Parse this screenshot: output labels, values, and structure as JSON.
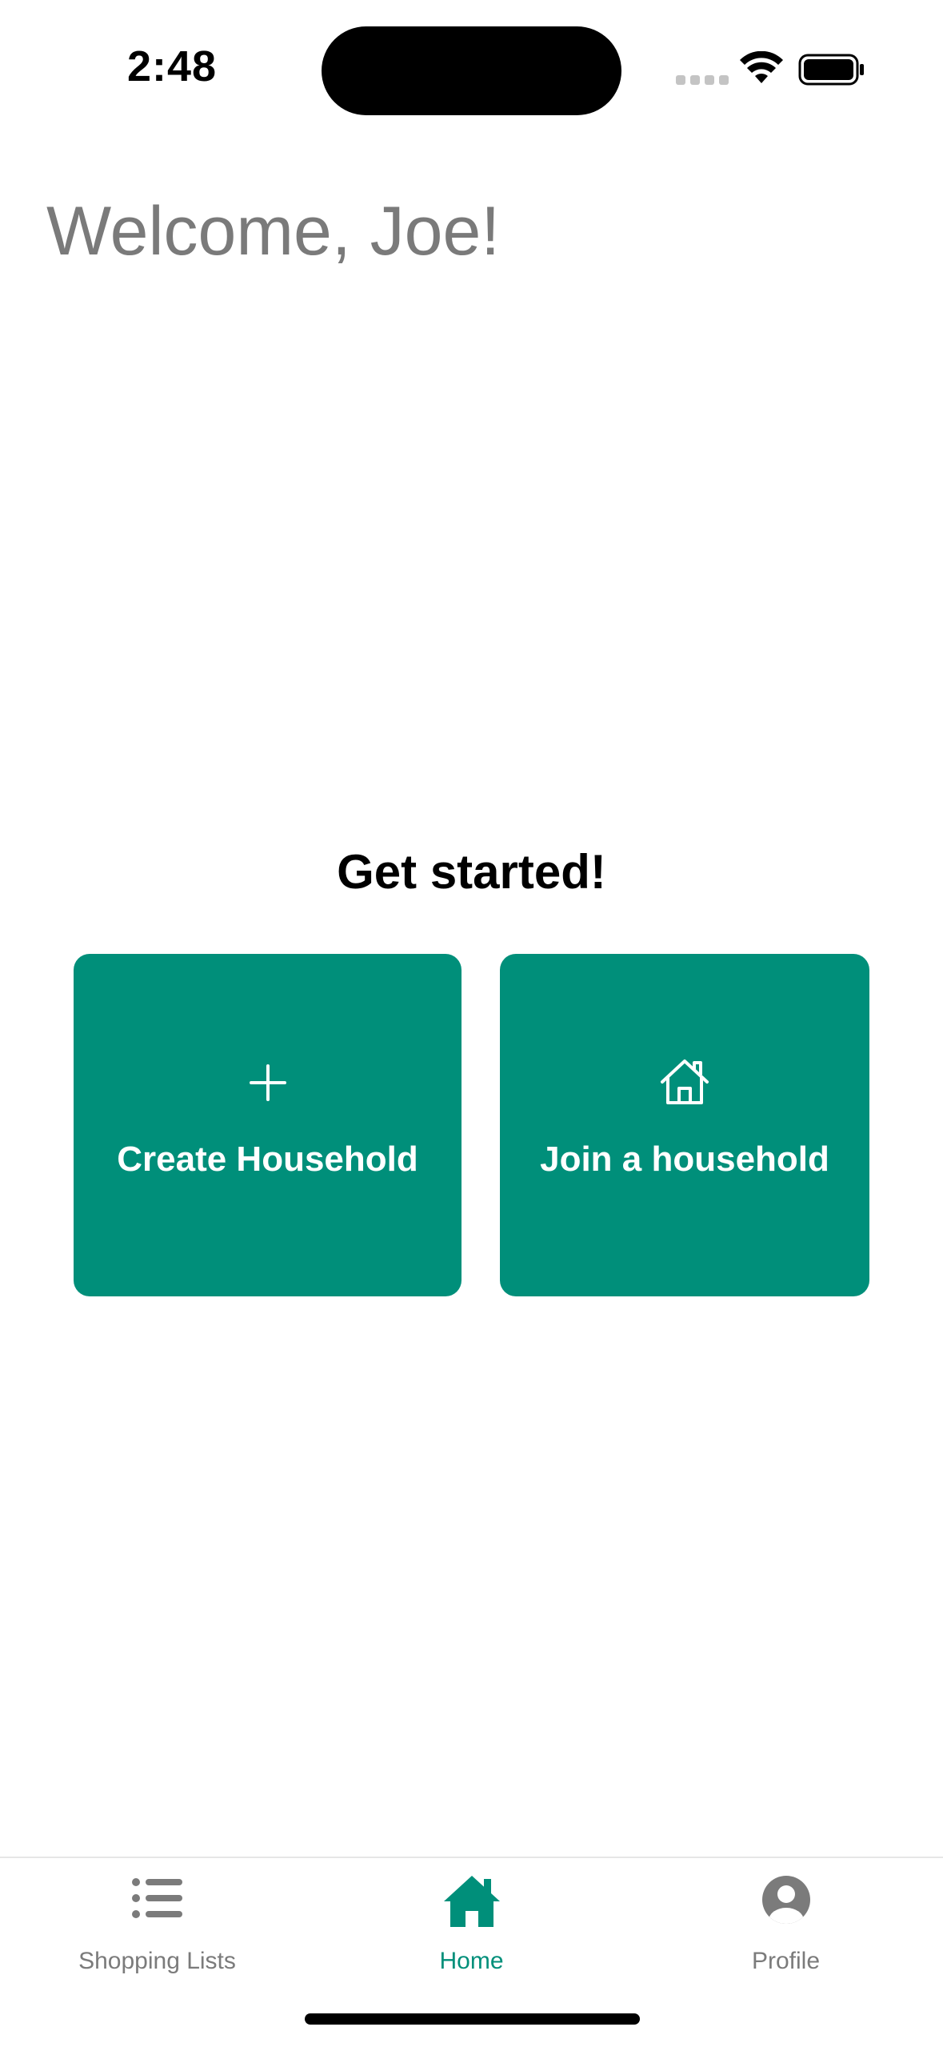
{
  "status_bar": {
    "time": "2:48"
  },
  "welcome": {
    "title": "Welcome, Joe!"
  },
  "get_started": {
    "heading": "Get started!"
  },
  "actions": {
    "create_label": "Create Household",
    "create_icon": "plus-icon",
    "join_label": "Join a household",
    "join_icon": "house-outline-icon"
  },
  "tab_bar": {
    "tabs": [
      {
        "label": "Shopping Lists",
        "icon": "list-icon",
        "active": false
      },
      {
        "label": "Home",
        "icon": "home-icon",
        "active": true
      },
      {
        "label": "Profile",
        "icon": "person-circle-icon",
        "active": false
      }
    ]
  },
  "colors": {
    "accent": "#008f7a",
    "inactive": "#7b7b7b",
    "welcome_text": "#7a7a7a"
  }
}
